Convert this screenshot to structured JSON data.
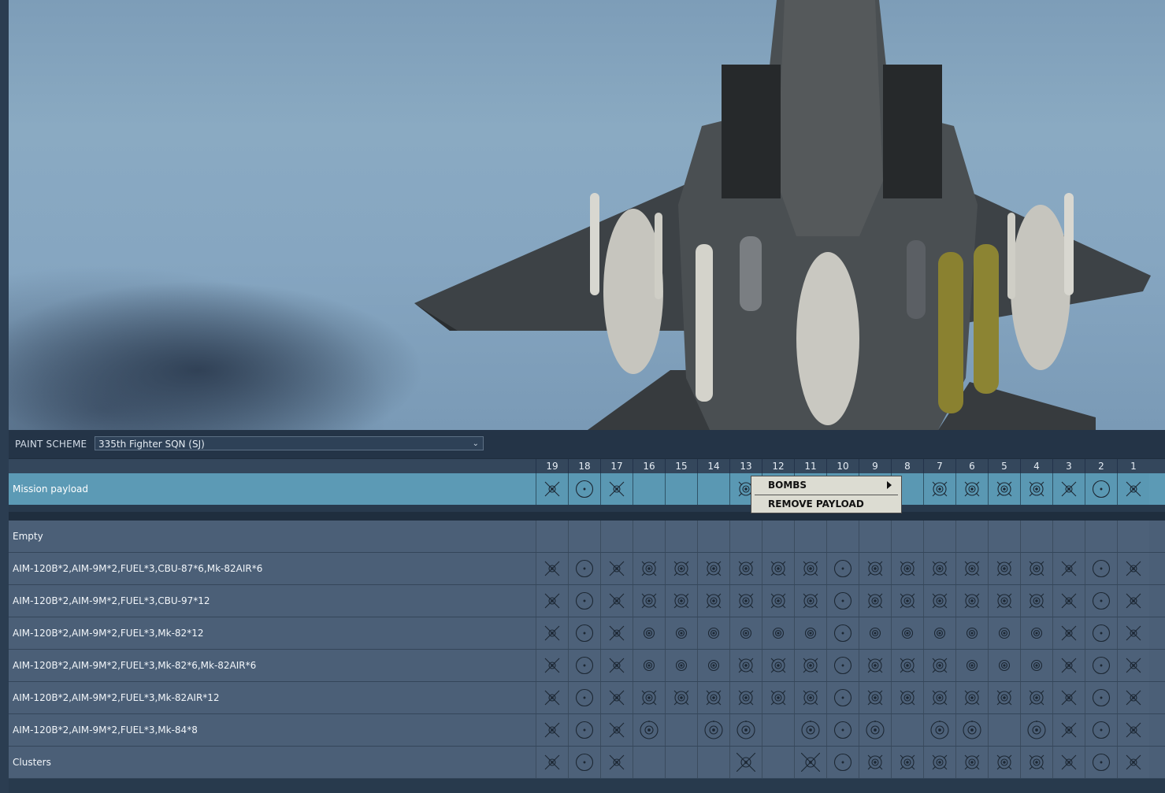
{
  "paint_scheme": {
    "label": "PAINT SCHEME",
    "value": "335th Fighter SQN (SJ)"
  },
  "stations": [
    "19",
    "18",
    "17",
    "16",
    "15",
    "14",
    "13",
    "12",
    "11",
    "10",
    "9",
    "8",
    "7",
    "6",
    "5",
    "4",
    "3",
    "2",
    "1"
  ],
  "mission_row": {
    "name": "Mission payload",
    "cells": [
      "missile",
      "tank",
      "missile",
      "",
      "",
      "",
      "cluster",
      "",
      "",
      "",
      "",
      "",
      "cluster",
      "cluster",
      "cluster",
      "cluster",
      "missile",
      "tank",
      "missile"
    ]
  },
  "loadouts": [
    {
      "name": "Empty",
      "cells": [
        "",
        "",
        "",
        "",
        "",
        "",
        "",
        "",
        "",
        "",
        "",
        "",
        "",
        "",
        "",
        "",
        "",
        "",
        ""
      ]
    },
    {
      "name": "AIM-120B*2,AIM-9M*2,FUEL*3,CBU-87*6,Mk-82AIR*6",
      "cells": [
        "missile",
        "tank",
        "missile",
        "cluster",
        "cluster",
        "cluster",
        "cluster",
        "cluster",
        "cluster",
        "tank",
        "cluster",
        "cluster",
        "cluster",
        "cluster",
        "cluster",
        "cluster",
        "missile",
        "tank",
        "missile"
      ]
    },
    {
      "name": "AIM-120B*2,AIM-9M*2,FUEL*3,CBU-97*12",
      "cells": [
        "missile",
        "tank",
        "missile",
        "cluster",
        "cluster",
        "cluster",
        "cluster",
        "cluster",
        "cluster",
        "tank",
        "cluster",
        "cluster",
        "cluster",
        "cluster",
        "cluster",
        "cluster",
        "missile",
        "tank",
        "missile"
      ]
    },
    {
      "name": "AIM-120B*2,AIM-9M*2,FUEL*3,Mk-82*12",
      "cells": [
        "missile",
        "tank",
        "missile",
        "bomb",
        "bomb",
        "bomb",
        "bomb",
        "bomb",
        "bomb",
        "tank",
        "bomb",
        "bomb",
        "bomb",
        "bomb",
        "bomb",
        "bomb",
        "missile",
        "tank",
        "missile"
      ]
    },
    {
      "name": "AIM-120B*2,AIM-9M*2,FUEL*3,Mk-82*6,Mk-82AIR*6",
      "cells": [
        "missile",
        "tank",
        "missile",
        "bomb",
        "bomb",
        "bomb",
        "cluster",
        "cluster",
        "cluster",
        "tank",
        "cluster",
        "cluster",
        "cluster",
        "bomb",
        "bomb",
        "bomb",
        "missile",
        "tank",
        "missile"
      ]
    },
    {
      "name": "AIM-120B*2,AIM-9M*2,FUEL*3,Mk-82AIR*12",
      "cells": [
        "missile",
        "tank",
        "missile",
        "cluster",
        "cluster",
        "cluster",
        "cluster",
        "cluster",
        "cluster",
        "tank",
        "cluster",
        "cluster",
        "cluster",
        "cluster",
        "cluster",
        "cluster",
        "missile",
        "tank",
        "missile"
      ]
    },
    {
      "name": "AIM-120B*2,AIM-9M*2,FUEL*3,Mk-84*8",
      "cells": [
        "missile",
        "tank",
        "missile",
        "bigbomb",
        "",
        "bigbomb",
        "bigbomb",
        "",
        "bigbomb",
        "tank",
        "bigbomb",
        "",
        "bigbomb",
        "bigbomb",
        "",
        "bigbomb",
        "missile",
        "tank",
        "missile"
      ]
    },
    {
      "name": "Clusters",
      "cells": [
        "missile",
        "tank",
        "missile",
        "",
        "",
        "",
        "bigx",
        "",
        "bigx",
        "tank",
        "cluster",
        "cluster",
        "cluster",
        "cluster",
        "cluster",
        "cluster",
        "missile",
        "tank",
        "missile"
      ]
    }
  ],
  "context_menu": {
    "items": [
      {
        "label": "BOMBS",
        "has_submenu": true
      },
      {
        "label": "REMOVE PAYLOAD",
        "has_submenu": false
      }
    ]
  }
}
